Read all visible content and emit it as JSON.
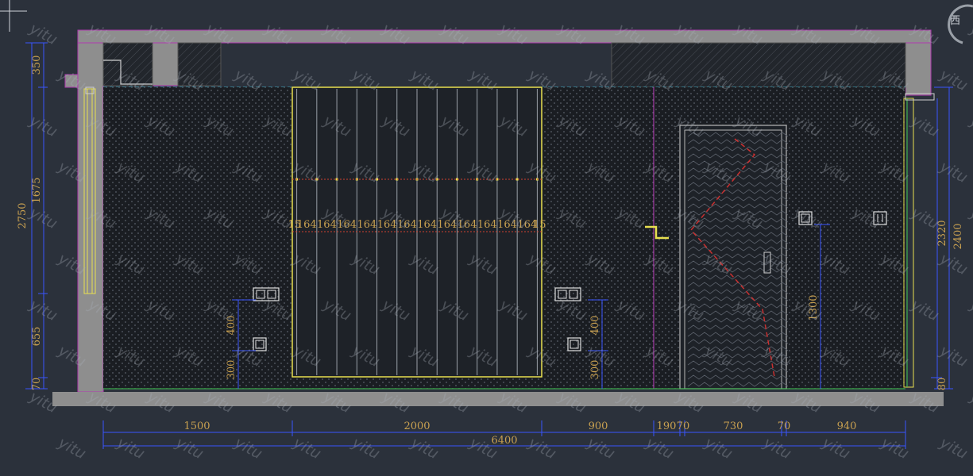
{
  "watermark": "yitu",
  "view_label": "西",
  "colors": {
    "background": "#2b313b",
    "wall": "#8e8e8e",
    "wall_outline": "#b03ab0",
    "panel": "#1a1d22",
    "dimension": "#3a55ff",
    "dimension_text": "#c8a050",
    "highlight": "#e8e050",
    "accent_red": "#c83030"
  },
  "dimensions": {
    "horizontal_bottom": [
      "1500",
      "2000",
      "900",
      "190",
      "70",
      "730",
      "70",
      "940"
    ],
    "total_width": "6400",
    "panel_slats": [
      "15",
      "164",
      "164",
      "164",
      "164",
      "164",
      "164",
      "164",
      "164",
      "164",
      "164",
      "164",
      "164",
      "15"
    ],
    "left_total": "2750",
    "left_segments": [
      "350",
      "1675",
      "655",
      "70"
    ],
    "right_total": "2400",
    "right_upper": "2320",
    "right_lower": "80",
    "door_height": "1300",
    "socket_left_upper": "400",
    "socket_left_lower": "300",
    "socket_mid_upper": "400",
    "socket_mid_lower": "300"
  }
}
